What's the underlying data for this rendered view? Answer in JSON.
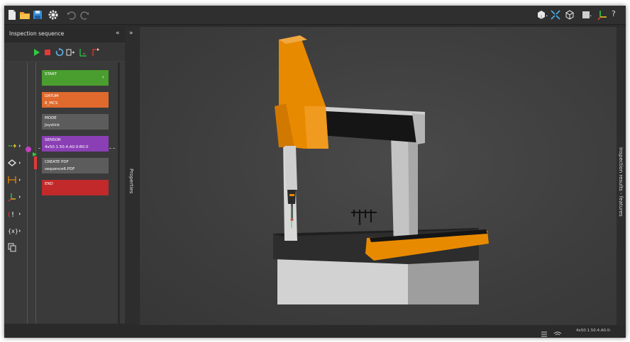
{
  "panel": {
    "title": "Inspection sequence",
    "collapse_icon": "«"
  },
  "properties": {
    "title": "Properties",
    "expand_icon": "»"
  },
  "results": {
    "title": "Inspection results - features"
  },
  "sequence": [
    {
      "title": "START",
      "subtitle": "",
      "color": "#4a9e2f"
    },
    {
      "title": "DATUM",
      "subtitle": "8_MCS",
      "color": "#e06a2e"
    },
    {
      "title": "MODE",
      "subtitle": "Joystick",
      "color": "#5c5c5c"
    },
    {
      "title": "SENSOR",
      "subtitle": "4x50.1.50.4.A0.0-B0.0",
      "color": "#8b3fb5"
    },
    {
      "title": "CREATE PDF",
      "subtitle": "sequence6.PDF",
      "color": "#5c5c5c"
    },
    {
      "title": "END",
      "subtitle": "",
      "color": "#c2292b"
    }
  ],
  "status": {
    "sensor_text": "4x50.1.50.4.A0.0-"
  },
  "colors": {
    "machine_orange": "#e88a00",
    "accent_green": "#2ecc40",
    "stop_red": "#e53935"
  }
}
